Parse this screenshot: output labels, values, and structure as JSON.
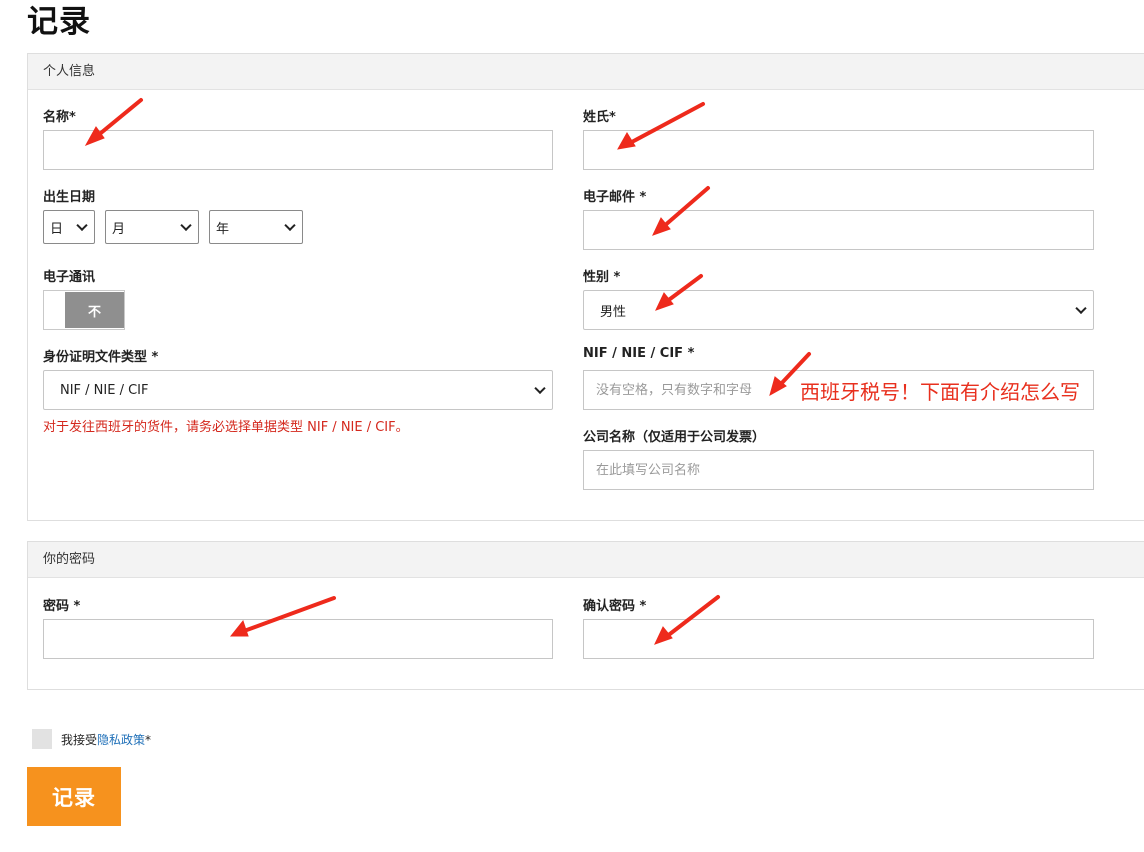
{
  "page": {
    "title": "记录"
  },
  "personal": {
    "heading": "个人信息",
    "first_name": {
      "label": "名称*",
      "value": ""
    },
    "last_name": {
      "label": "姓氏*",
      "value": ""
    },
    "birth_date": {
      "label": "出生日期",
      "day": "日",
      "month": "月",
      "year": "年"
    },
    "email": {
      "label": "电子邮件 *",
      "value": ""
    },
    "newsletter": {
      "label": "电子通讯",
      "state": "不"
    },
    "gender": {
      "label": "性别 *",
      "value": "男性"
    },
    "id_type": {
      "label": "身份证明文件类型 *",
      "value": "NIF / NIE / CIF",
      "note": "对于发往西班牙的货件，请务必选择单据类型 NIF / NIE / CIF。"
    },
    "nif": {
      "label": "NIF / NIE / CIF *",
      "placeholder": "没有空格，只有数字和字母",
      "annotation": "西班牙税号！下面有介绍怎么写"
    },
    "company": {
      "label": "公司名称（仅适用于公司发票）",
      "placeholder": "在此填写公司名称"
    }
  },
  "password": {
    "heading": "你的密码",
    "password": {
      "label": "密码 *",
      "value": ""
    },
    "confirm": {
      "label": "确认密码 *",
      "value": ""
    }
  },
  "consent": {
    "text": "我接受",
    "link": "隐私政策",
    "suffix": "*"
  },
  "submit": {
    "label": "记录"
  },
  "colors": {
    "accent": "#f6921e",
    "note_red": "#d4281d",
    "annotation_red": "#e8301e",
    "link_blue": "#1e6fb8"
  }
}
